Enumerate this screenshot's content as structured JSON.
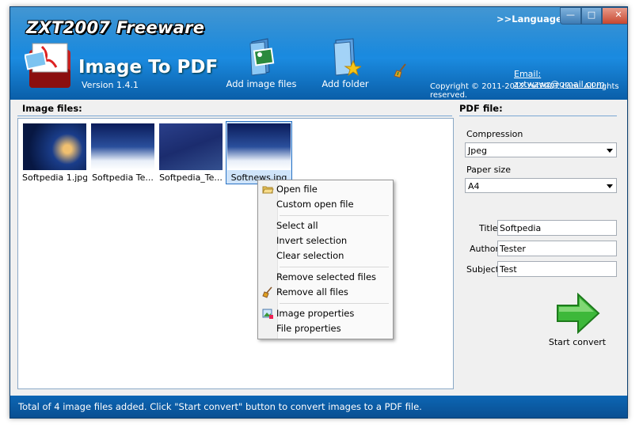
{
  "header": {
    "brand": "ZXT2007 Freeware",
    "product": "Image To PDF",
    "version": "Version 1.4.1",
    "language_link": ">>Language",
    "email": "Email: zxtwzwz@gmail.com",
    "copyright": "Copyright ©  2011-2012 zxt2007.com. All rights reserved.",
    "add_images_label": "Add image files",
    "add_folder_label": "Add folder"
  },
  "files": {
    "title": "Image files:",
    "items": [
      {
        "name": "Softpedia 1.jpg"
      },
      {
        "name": "Softpedia Te..."
      },
      {
        "name": "Softpedia_Te..."
      },
      {
        "name": "Softnews.jpg"
      }
    ],
    "selected_index": 3
  },
  "context_menu": {
    "items": [
      {
        "label": "Open file",
        "icon": "folder-open-icon"
      },
      {
        "label": "Custom open file"
      },
      {
        "label": "Select all"
      },
      {
        "label": "Invert selection"
      },
      {
        "label": "Clear selection"
      },
      {
        "label": "Remove selected files"
      },
      {
        "label": "Remove all files",
        "icon": "broom-icon"
      },
      {
        "label": "Image properties",
        "icon": "image-properties-icon"
      },
      {
        "label": "File properties"
      }
    ]
  },
  "pdf": {
    "title": "PDF file:",
    "compression_label": "Compression",
    "compression_value": "Jpeg",
    "paper_label": "Paper size",
    "paper_value": "A4",
    "title_label": "Title",
    "title_value": "Softpedia",
    "author_label": "Author",
    "author_value": "Tester",
    "subject_label": "Subject",
    "subject_value": "Test",
    "start_label": "Start convert"
  },
  "status": {
    "text": "Total of 4 image files added. Click \"Start convert\" button to convert images to a PDF file."
  },
  "colors": {
    "header_blue": "#1b8be0",
    "status_blue": "#0a5ea8",
    "start_green": "#3db83a"
  }
}
